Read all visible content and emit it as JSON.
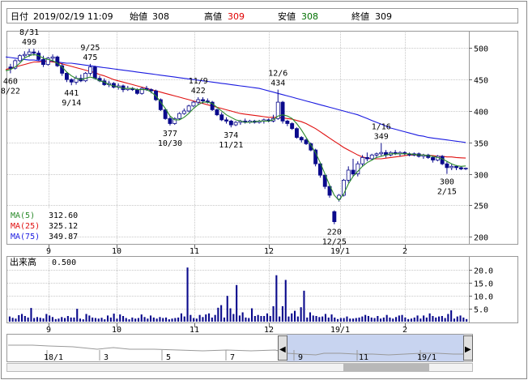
{
  "header": {
    "date_label": "日付",
    "date_value": "2019/02/19 11:09",
    "open_label": "始値",
    "open_value": "308",
    "high_label": "高値",
    "high_value": "309",
    "low_label": "安値",
    "low_value": "308",
    "close_label": "終値",
    "close_value": "309"
  },
  "colors": {
    "candle": "#0a0a8c",
    "ma5": "#2a8a2a",
    "ma25": "#e01010",
    "ma75": "#1a1ae0",
    "volume": "#0a0a8c",
    "high_text": "#e00000",
    "low_text": "#007000",
    "grid": "#c8c8c8"
  },
  "legend": [
    {
      "label": "MA(5)",
      "value": "312.60",
      "color_key": "ma5"
    },
    {
      "label": "MA(25)",
      "value": "325.12",
      "color_key": "ma25"
    },
    {
      "label": "MA(75)",
      "value": "349.87",
      "color_key": "ma75"
    }
  ],
  "volume_panel": {
    "label": "出来高",
    "unit": "0.500",
    "yticks": [
      "20.0",
      "15.0",
      "10.0",
      "5.0"
    ]
  },
  "navigator": {
    "labels": [
      "18/1",
      "3",
      "5",
      "7",
      "9",
      "11",
      "19/1"
    ],
    "left_handle_glyph": "◀",
    "right_handle_glyph": "▶"
  },
  "chart_data": {
    "type": "candlestick",
    "x_month_labels": [
      "9",
      "10",
      "11",
      "12",
      "19/1",
      "2"
    ],
    "price_yticks": [
      500,
      450,
      400,
      350,
      300,
      250,
      200
    ],
    "ylim": [
      190,
      525
    ],
    "volume_ylim": [
      0,
      22
    ],
    "candles": [
      {
        "o": 470,
        "h": 475,
        "l": 460,
        "c": 468
      },
      {
        "o": 468,
        "h": 482,
        "l": 466,
        "c": 480
      },
      {
        "o": 480,
        "h": 490,
        "l": 478,
        "c": 488
      },
      {
        "o": 488,
        "h": 495,
        "l": 484,
        "c": 490
      },
      {
        "o": 490,
        "h": 499,
        "l": 486,
        "c": 494
      },
      {
        "o": 494,
        "h": 499,
        "l": 488,
        "c": 492
      },
      {
        "o": 492,
        "h": 496,
        "l": 480,
        "c": 482
      },
      {
        "o": 482,
        "h": 488,
        "l": 470,
        "c": 474
      },
      {
        "o": 474,
        "h": 486,
        "l": 472,
        "c": 484
      },
      {
        "o": 484,
        "h": 490,
        "l": 478,
        "c": 486
      },
      {
        "o": 486,
        "h": 488,
        "l": 470,
        "c": 472
      },
      {
        "o": 472,
        "h": 476,
        "l": 456,
        "c": 460
      },
      {
        "o": 460,
        "h": 462,
        "l": 446,
        "c": 450
      },
      {
        "o": 450,
        "h": 452,
        "l": 441,
        "c": 446
      },
      {
        "o": 446,
        "h": 456,
        "l": 442,
        "c": 452
      },
      {
        "o": 452,
        "h": 458,
        "l": 446,
        "c": 448
      },
      {
        "o": 448,
        "h": 462,
        "l": 446,
        "c": 460
      },
      {
        "o": 460,
        "h": 475,
        "l": 456,
        "c": 470
      },
      {
        "o": 470,
        "h": 472,
        "l": 450,
        "c": 452
      },
      {
        "o": 452,
        "h": 456,
        "l": 446,
        "c": 448
      },
      {
        "o": 448,
        "h": 452,
        "l": 440,
        "c": 442
      },
      {
        "o": 442,
        "h": 448,
        "l": 438,
        "c": 444
      },
      {
        "o": 444,
        "h": 446,
        "l": 436,
        "c": 438
      },
      {
        "o": 438,
        "h": 444,
        "l": 434,
        "c": 440
      },
      {
        "o": 440,
        "h": 442,
        "l": 430,
        "c": 434
      },
      {
        "o": 434,
        "h": 440,
        "l": 432,
        "c": 436
      },
      {
        "o": 436,
        "h": 438,
        "l": 432,
        "c": 434
      },
      {
        "o": 434,
        "h": 436,
        "l": 426,
        "c": 428
      },
      {
        "o": 428,
        "h": 438,
        "l": 426,
        "c": 436
      },
      {
        "o": 436,
        "h": 440,
        "l": 432,
        "c": 434
      },
      {
        "o": 434,
        "h": 436,
        "l": 428,
        "c": 432
      },
      {
        "o": 432,
        "h": 434,
        "l": 416,
        "c": 418
      },
      {
        "o": 418,
        "h": 420,
        "l": 400,
        "c": 402
      },
      {
        "o": 402,
        "h": 404,
        "l": 386,
        "c": 388
      },
      {
        "o": 388,
        "h": 392,
        "l": 377,
        "c": 380
      },
      {
        "o": 380,
        "h": 390,
        "l": 378,
        "c": 388
      },
      {
        "o": 388,
        "h": 398,
        "l": 386,
        "c": 396
      },
      {
        "o": 396,
        "h": 404,
        "l": 394,
        "c": 400
      },
      {
        "o": 400,
        "h": 410,
        "l": 398,
        "c": 408
      },
      {
        "o": 408,
        "h": 416,
        "l": 406,
        "c": 414
      },
      {
        "o": 414,
        "h": 422,
        "l": 410,
        "c": 418
      },
      {
        "o": 418,
        "h": 422,
        "l": 412,
        "c": 416
      },
      {
        "o": 416,
        "h": 420,
        "l": 412,
        "c": 414
      },
      {
        "o": 414,
        "h": 416,
        "l": 400,
        "c": 402
      },
      {
        "o": 402,
        "h": 404,
        "l": 392,
        "c": 394
      },
      {
        "o": 394,
        "h": 398,
        "l": 384,
        "c": 386
      },
      {
        "o": 386,
        "h": 390,
        "l": 380,
        "c": 384
      },
      {
        "o": 384,
        "h": 386,
        "l": 374,
        "c": 378
      },
      {
        "o": 378,
        "h": 384,
        "l": 376,
        "c": 382
      },
      {
        "o": 382,
        "h": 386,
        "l": 378,
        "c": 384
      },
      {
        "o": 384,
        "h": 388,
        "l": 380,
        "c": 382
      },
      {
        "o": 382,
        "h": 386,
        "l": 380,
        "c": 384
      },
      {
        "o": 384,
        "h": 386,
        "l": 380,
        "c": 382
      },
      {
        "o": 382,
        "h": 386,
        "l": 380,
        "c": 384
      },
      {
        "o": 384,
        "h": 388,
        "l": 380,
        "c": 386
      },
      {
        "o": 386,
        "h": 388,
        "l": 382,
        "c": 384
      },
      {
        "o": 384,
        "h": 394,
        "l": 382,
        "c": 388
      },
      {
        "o": 388,
        "h": 434,
        "l": 386,
        "c": 414
      },
      {
        "o": 414,
        "h": 416,
        "l": 380,
        "c": 384
      },
      {
        "o": 384,
        "h": 386,
        "l": 376,
        "c": 380
      },
      {
        "o": 380,
        "h": 382,
        "l": 370,
        "c": 372
      },
      {
        "o": 372,
        "h": 374,
        "l": 356,
        "c": 358
      },
      {
        "o": 358,
        "h": 360,
        "l": 350,
        "c": 354
      },
      {
        "o": 354,
        "h": 356,
        "l": 346,
        "c": 348
      },
      {
        "o": 348,
        "h": 350,
        "l": 336,
        "c": 338
      },
      {
        "o": 338,
        "h": 340,
        "l": 312,
        "c": 316
      },
      {
        "o": 316,
        "h": 318,
        "l": 294,
        "c": 298
      },
      {
        "o": 298,
        "h": 300,
        "l": 276,
        "c": 280
      },
      {
        "o": 280,
        "h": 282,
        "l": 262,
        "c": 266
      },
      {
        "o": 240,
        "h": 242,
        "l": 220,
        "c": 224
      },
      {
        "o": 260,
        "h": 268,
        "l": 256,
        "c": 266
      },
      {
        "o": 266,
        "h": 292,
        "l": 264,
        "c": 290
      },
      {
        "o": 290,
        "h": 312,
        "l": 286,
        "c": 306
      },
      {
        "o": 306,
        "h": 324,
        "l": 296,
        "c": 300
      },
      {
        "o": 300,
        "h": 320,
        "l": 296,
        "c": 316
      },
      {
        "o": 316,
        "h": 330,
        "l": 312,
        "c": 326
      },
      {
        "o": 326,
        "h": 334,
        "l": 320,
        "c": 324
      },
      {
        "o": 324,
        "h": 332,
        "l": 322,
        "c": 330
      },
      {
        "o": 330,
        "h": 334,
        "l": 326,
        "c": 332
      },
      {
        "o": 332,
        "h": 349,
        "l": 328,
        "c": 334
      },
      {
        "o": 334,
        "h": 338,
        "l": 326,
        "c": 330
      },
      {
        "o": 330,
        "h": 336,
        "l": 328,
        "c": 334
      },
      {
        "o": 334,
        "h": 338,
        "l": 330,
        "c": 332
      },
      {
        "o": 332,
        "h": 336,
        "l": 328,
        "c": 334
      },
      {
        "o": 334,
        "h": 336,
        "l": 330,
        "c": 332
      },
      {
        "o": 332,
        "h": 334,
        "l": 328,
        "c": 330
      },
      {
        "o": 330,
        "h": 334,
        "l": 328,
        "c": 332
      },
      {
        "o": 332,
        "h": 334,
        "l": 326,
        "c": 328
      },
      {
        "o": 328,
        "h": 332,
        "l": 324,
        "c": 330
      },
      {
        "o": 330,
        "h": 332,
        "l": 324,
        "c": 326
      },
      {
        "o": 326,
        "h": 328,
        "l": 318,
        "c": 322
      },
      {
        "o": 322,
        "h": 330,
        "l": 320,
        "c": 328
      },
      {
        "o": 328,
        "h": 330,
        "l": 314,
        "c": 316
      },
      {
        "o": 316,
        "h": 320,
        "l": 300,
        "c": 310
      },
      {
        "o": 310,
        "h": 316,
        "l": 306,
        "c": 312
      },
      {
        "o": 312,
        "h": 314,
        "l": 306,
        "c": 310
      },
      {
        "o": 310,
        "h": 312,
        "l": 306,
        "c": 308
      },
      {
        "o": 308,
        "h": 310,
        "l": 306,
        "c": 309
      }
    ],
    "ma5": [
      464,
      466,
      470,
      476,
      484,
      488,
      490,
      488,
      484,
      482,
      480,
      476,
      470,
      462,
      456,
      452,
      450,
      452,
      454,
      452,
      448,
      446,
      442,
      440,
      438,
      436,
      436,
      436,
      434,
      434,
      434,
      430,
      424,
      414,
      404,
      392,
      386,
      386,
      390,
      396,
      404,
      410,
      414,
      414,
      412,
      406,
      400,
      394,
      390,
      386,
      384,
      382,
      382,
      383,
      384,
      384,
      384,
      386,
      392,
      394,
      392,
      388,
      380,
      370,
      358,
      346,
      334,
      318,
      300,
      282,
      266,
      258,
      268,
      284,
      296,
      304,
      312,
      318,
      322,
      326,
      328,
      330,
      332,
      332,
      332,
      332,
      332,
      331,
      330,
      330,
      329,
      328,
      326,
      324,
      320,
      316,
      313,
      312,
      312.6
    ],
    "ma25": [
      466,
      468,
      470,
      472,
      474,
      476,
      478,
      478,
      479,
      479,
      478,
      477,
      475,
      473,
      471,
      469,
      467,
      465,
      463,
      461,
      458,
      456,
      453,
      450,
      448,
      446,
      444,
      442,
      440,
      438,
      436,
      434,
      432,
      430,
      428,
      426,
      424,
      422,
      420,
      418,
      416,
      414,
      412,
      410,
      408,
      406,
      404,
      402,
      400,
      398,
      396,
      395,
      394,
      393,
      392,
      391,
      390,
      390,
      390,
      389,
      388,
      387,
      385,
      383,
      380,
      376,
      372,
      367,
      362,
      357,
      352,
      347,
      342,
      338,
      334,
      330,
      327,
      325,
      324,
      324,
      324,
      325,
      326,
      327,
      328,
      329,
      330,
      330,
      330,
      330,
      329,
      329,
      328,
      328,
      327,
      327,
      326,
      325.5,
      325.12
    ],
    "ma75": [
      486,
      485,
      484,
      483,
      482,
      481,
      481,
      480,
      480,
      479,
      479,
      478,
      477,
      476,
      476,
      475,
      474,
      473,
      472,
      471,
      470,
      469,
      468,
      467,
      466,
      465,
      464,
      463,
      462,
      461,
      460,
      459,
      458,
      457,
      456,
      455,
      454,
      453,
      452,
      451,
      450,
      449,
      448,
      447,
      446,
      445,
      444,
      443,
      442,
      441,
      440,
      439,
      438,
      437,
      436,
      434,
      432,
      430,
      428,
      426,
      424,
      422,
      420,
      418,
      416,
      414,
      412,
      410,
      408,
      406,
      404,
      402,
      400,
      398,
      396,
      394,
      391,
      388,
      385,
      382,
      379,
      376,
      373,
      371,
      369,
      367,
      365,
      363,
      361,
      360,
      358,
      357,
      356,
      355,
      354,
      353,
      352,
      351,
      349.87
    ],
    "volume": [
      2,
      1.5,
      1.2,
      2.5,
      3,
      2.2,
      1.6,
      5.3,
      1.4,
      1.8,
      1.5,
      1.3,
      3,
      2.4,
      1.8,
      1,
      1.2,
      1.8,
      1.4,
      2.2,
      1.6,
      1.6,
      5,
      1.2,
      0.9,
      3,
      2.4,
      1.6,
      1.4,
      1.2,
      1.5,
      0.9,
      2.4,
      1.6,
      3.1,
      1.2,
      2.8,
      2.2,
      1.4,
      0.9,
      1.6,
      1.2,
      1.4,
      2.8,
      1.8,
      1.2,
      2.4,
      1.6,
      1.2,
      1.8,
      1.4,
      1.6,
      0.9,
      1.2,
      1.4,
      1.6,
      3.2,
      2,
      21,
      2.6,
      1.4,
      1.2,
      2.6,
      1.8,
      2.8,
      3.2,
      1.6,
      2.6,
      5.4,
      6.4,
      1.6,
      10,
      5.2,
      3,
      14.2,
      2.4,
      3.6,
      1.6,
      1.4,
      5.2,
      2.2,
      2.6,
      2.2,
      2.2,
      3.2,
      2.2,
      6,
      18,
      2,
      6,
      16.2,
      2,
      3.2,
      4.2,
      2,
      5.6,
      12,
      1.6,
      3.6,
      2.4,
      2.2,
      1.8,
      2,
      3,
      1.6,
      2.8,
      1.6,
      1,
      1.4,
      1.4,
      2,
      1.2,
      1.2,
      1.4,
      1.6,
      2,
      2.6,
      2.2,
      1.6,
      1.4,
      2.2,
      1.2,
      1.6,
      2.6,
      1.6,
      1.2,
      1.8,
      2.4,
      2.6,
      1.6,
      1,
      1.2,
      1.6,
      2.4,
      1.2,
      2.4,
      1.6,
      3.2,
      2.2,
      1.6,
      2,
      2.2,
      1.4,
      3,
      4.4,
      1.2,
      2,
      2.4,
      1.6,
      1
    ],
    "annotations": [
      {
        "i": 0,
        "text": "460",
        "sub": "8/22",
        "pos": "below"
      },
      {
        "i": 4,
        "text": "8/31",
        "sub": "499",
        "pos": "above"
      },
      {
        "i": 13,
        "text": "441",
        "sub": "9/14",
        "pos": "below"
      },
      {
        "i": 17,
        "text": "9/25",
        "sub": "475",
        "pos": "above"
      },
      {
        "i": 34,
        "text": "377",
        "sub": "10/30",
        "pos": "below"
      },
      {
        "i": 40,
        "text": "11/9",
        "sub": "422",
        "pos": "above"
      },
      {
        "i": 47,
        "text": "374",
        "sub": "11/21",
        "pos": "below"
      },
      {
        "i": 57,
        "text": "12/6",
        "sub": "434",
        "pos": "above"
      },
      {
        "i": 69,
        "text": "220",
        "sub": "12/25",
        "pos": "below"
      },
      {
        "i": 79,
        "text": "1/16",
        "sub": "349",
        "pos": "above"
      },
      {
        "i": 93,
        "text": "300",
        "sub": "2/15",
        "pos": "below"
      }
    ]
  }
}
